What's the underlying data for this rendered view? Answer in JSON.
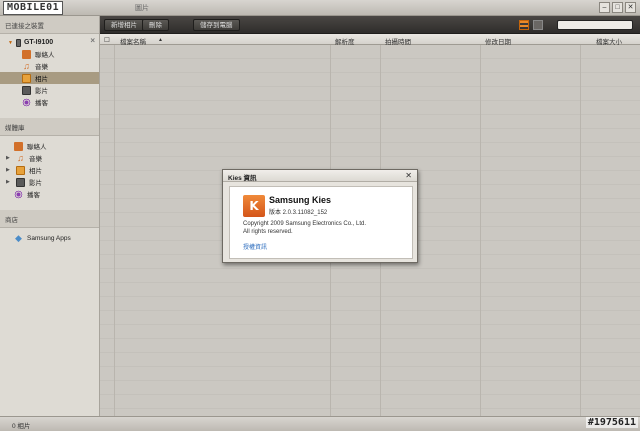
{
  "watermark": "MOBILE01",
  "window": {
    "title": "圖片",
    "controls": {
      "minimize": "‒",
      "maximize": "□",
      "close": "✕"
    }
  },
  "sidebar": {
    "connected_header": "已連接之裝置",
    "device": {
      "name": "GT-I9100",
      "close": "×"
    },
    "device_items": [
      {
        "label": "聯絡人",
        "icon": "contacts-icon"
      },
      {
        "label": "音樂",
        "icon": "music-icon"
      },
      {
        "label": "相片",
        "icon": "photo-icon",
        "selected": true
      },
      {
        "label": "影片",
        "icon": "video-icon"
      },
      {
        "label": "播客",
        "icon": "podcast-icon"
      }
    ],
    "library_header": "媒體庫",
    "library_items": [
      {
        "label": "聯絡人",
        "icon": "contacts-icon"
      },
      {
        "label": "音樂",
        "icon": "music-icon"
      },
      {
        "label": "相片",
        "icon": "photo-icon"
      },
      {
        "label": "影片",
        "icon": "video-icon"
      },
      {
        "label": "播客",
        "icon": "podcast-icon"
      }
    ],
    "store_header": "商店",
    "store_items": [
      {
        "label": "Samsung Apps",
        "icon": "apps-icon"
      }
    ]
  },
  "toolbar": {
    "add_photo": "新增相片",
    "delete": "刪除",
    "save_to_pc": "儲存到電腦",
    "search_placeholder": ""
  },
  "table": {
    "columns": [
      "檔案名稱",
      "解析度",
      "拍攝時間",
      "修改日期",
      "檔案大小"
    ]
  },
  "status": {
    "count": "0 相片",
    "stamp": "#1975611"
  },
  "dialog": {
    "title": "Kies 資訊",
    "close": "✕",
    "logo_text": "K",
    "app_name": "Samsung Kies",
    "version": "版本 2.0.3.11082_152",
    "copyright": "Copyright 2009 Samsung Electronics Co., Ltd.",
    "rights": "All rights reserved.",
    "license_link": "授權資訊"
  },
  "colors": {
    "accent": "#d2702a",
    "selection": "#a89b82",
    "toolbar": "#3a3835",
    "link": "#2a6bbd"
  }
}
